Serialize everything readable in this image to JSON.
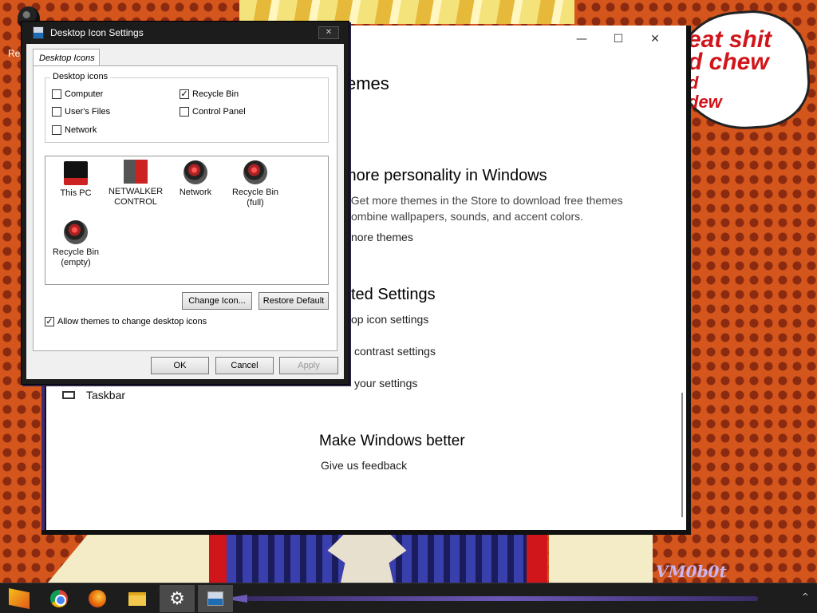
{
  "desktop": {
    "icon_label": "Re"
  },
  "wallpaper": {
    "speech_lines": [
      "eat shit",
      "d chew",
      "d",
      "dew"
    ],
    "signature": "VM0b0t"
  },
  "settings_window": {
    "title_partial": "emes",
    "controls": {
      "minimize": "—",
      "maximize": "☐",
      "close": "✕"
    },
    "personality_heading": "more personality in Windows",
    "personality_body_1": ": Get more themes in the Store to download free themes",
    "personality_body_2": "ombine wallpapers, sounds, and accent colors.",
    "personality_link": "nore themes",
    "related_heading": "ted Settings",
    "related_links": [
      "op icon settings",
      "contrast settings",
      "your settings"
    ],
    "taskbar_item": "Taskbar",
    "better_heading": "Make Windows better",
    "feedback_link": "Give us feedback"
  },
  "dialog": {
    "title": "Desktop Icon Settings",
    "close": "✕",
    "tab": "Desktop Icons",
    "group_label": "Desktop icons",
    "checkboxes": [
      {
        "label": "Computer",
        "checked": false
      },
      {
        "label": "Recycle Bin",
        "checked": true
      },
      {
        "label": "User's Files",
        "checked": false
      },
      {
        "label": "Control Panel",
        "checked": false
      },
      {
        "label": "Network",
        "checked": false
      }
    ],
    "icons": [
      {
        "line1": "This PC",
        "line2": "",
        "icon": "monitor-icon"
      },
      {
        "line1": "NETWALKER",
        "line2": "CONTROL",
        "icon": "user-folder-icon"
      },
      {
        "line1": "Network",
        "line2": "",
        "icon": "network-icon"
      },
      {
        "line1": "Recycle Bin",
        "line2": "(full)",
        "icon": "recycle-bin-full-icon"
      },
      {
        "line1": "Recycle Bin",
        "line2": "(empty)",
        "icon": "recycle-bin-empty-icon"
      }
    ],
    "change_icon": "Change Icon...",
    "restore_default": "Restore Default",
    "allow_themes": {
      "label": "Allow themes to change desktop icons",
      "checked": true
    },
    "ok": "OK",
    "cancel": "Cancel",
    "apply": "Apply"
  },
  "taskbar": {
    "items": [
      "start-icon",
      "chrome-icon",
      "firefox-icon",
      "file-explorer-icon",
      "settings-icon",
      "control-panel-icon"
    ],
    "tray_arrow": "^"
  },
  "colors": {
    "wallpaper_orange": "#d4561c",
    "accent_purple": "#6b58b7",
    "speech_red": "#d0151b"
  }
}
